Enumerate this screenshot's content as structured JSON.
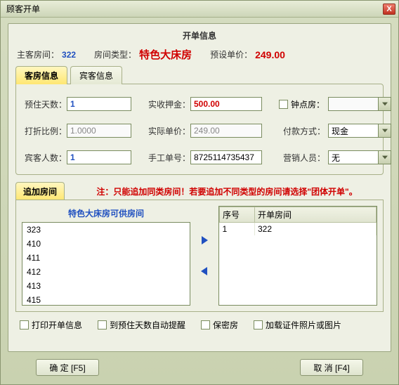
{
  "window": {
    "title": "顾客开单"
  },
  "panel": {
    "title": "开单信息"
  },
  "header": {
    "main_room_label": "主客房间：",
    "main_room_value": "322",
    "room_type_label": "房间类型：",
    "room_type_value": "特色大床房",
    "preset_price_label": "预设单价：",
    "preset_price_value": "249.00"
  },
  "tabs": {
    "room_info": "客房信息",
    "guest_info": "宾客信息"
  },
  "form": {
    "days_label": "预住天数：",
    "days_value": "1",
    "deposit_label": "实收押金：",
    "deposit_value": "500.00",
    "clock_room_label": "钟点房：",
    "clock_room_value": "",
    "discount_label": "打折比例：",
    "discount_value": "1.0000",
    "actual_price_label": "实际单价：",
    "actual_price_value": "249.00",
    "pay_method_label": "付款方式：",
    "pay_method_value": "现金",
    "guest_count_label": "宾客人数：",
    "guest_count_value": "1",
    "manual_no_label": "手工单号：",
    "manual_no_value": "8725114735437",
    "sales_label": "营销人员：",
    "sales_value": "无"
  },
  "add": {
    "tab_label": "追加房间",
    "note": "注：只能追加同类房间！若要追加不同类型的房间请选择\"团体开单\"。",
    "available_title": "特色大床房可供房间",
    "available_items": [
      "323",
      "410",
      "411",
      "412",
      "413",
      "415"
    ],
    "table_cols": {
      "seq": "序号",
      "room": "开单房间"
    },
    "table_rows": [
      {
        "seq": "1",
        "room": "322"
      }
    ]
  },
  "checks": {
    "print": "打印开单信息",
    "auto_remind": "到预住天数自动提醒",
    "secret": "保密房",
    "load_id_photo": "加载证件照片或图片"
  },
  "buttons": {
    "ok": "确 定 [F5]",
    "cancel": "取 消 [F4]"
  }
}
